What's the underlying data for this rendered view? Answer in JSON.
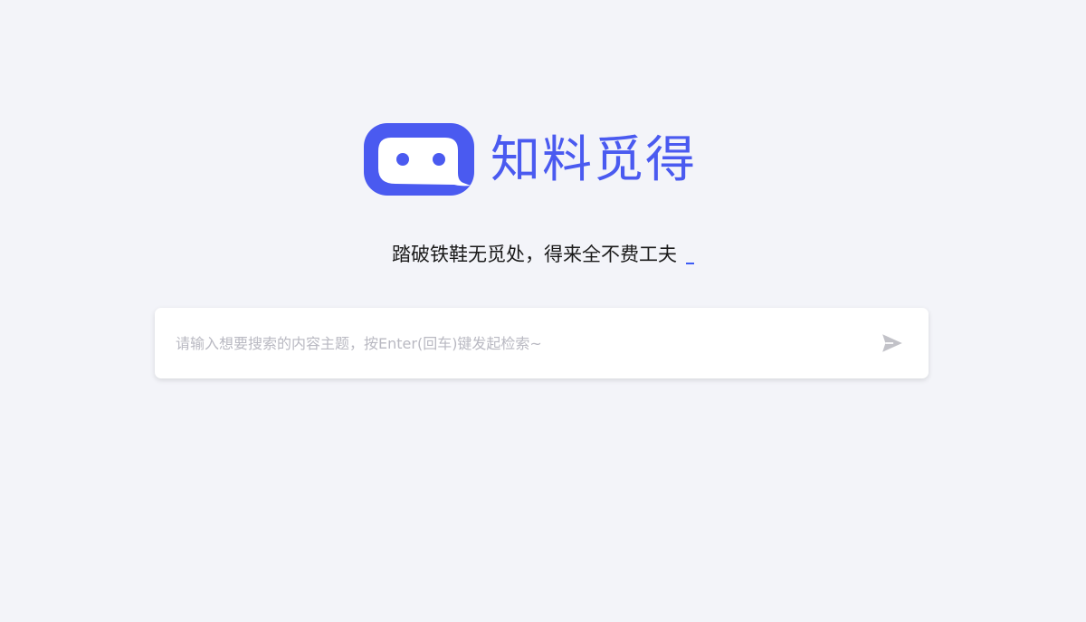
{
  "brand": {
    "name": "知料觅得",
    "logo_icon": "chat-bubble-robot-face-icon",
    "color": "#4a5af0"
  },
  "slogan": {
    "text": "踏破铁鞋无觅处，得来全不费工夫"
  },
  "search": {
    "value": "",
    "placeholder": "请输入想要搜索的内容主题，按Enter(回车)键发起检索~",
    "submit_icon": "send-paper-plane-icon"
  },
  "colors": {
    "background": "#f3f4f9",
    "accent": "#3d5cf5",
    "icon_gray": "#c2c2c8"
  }
}
